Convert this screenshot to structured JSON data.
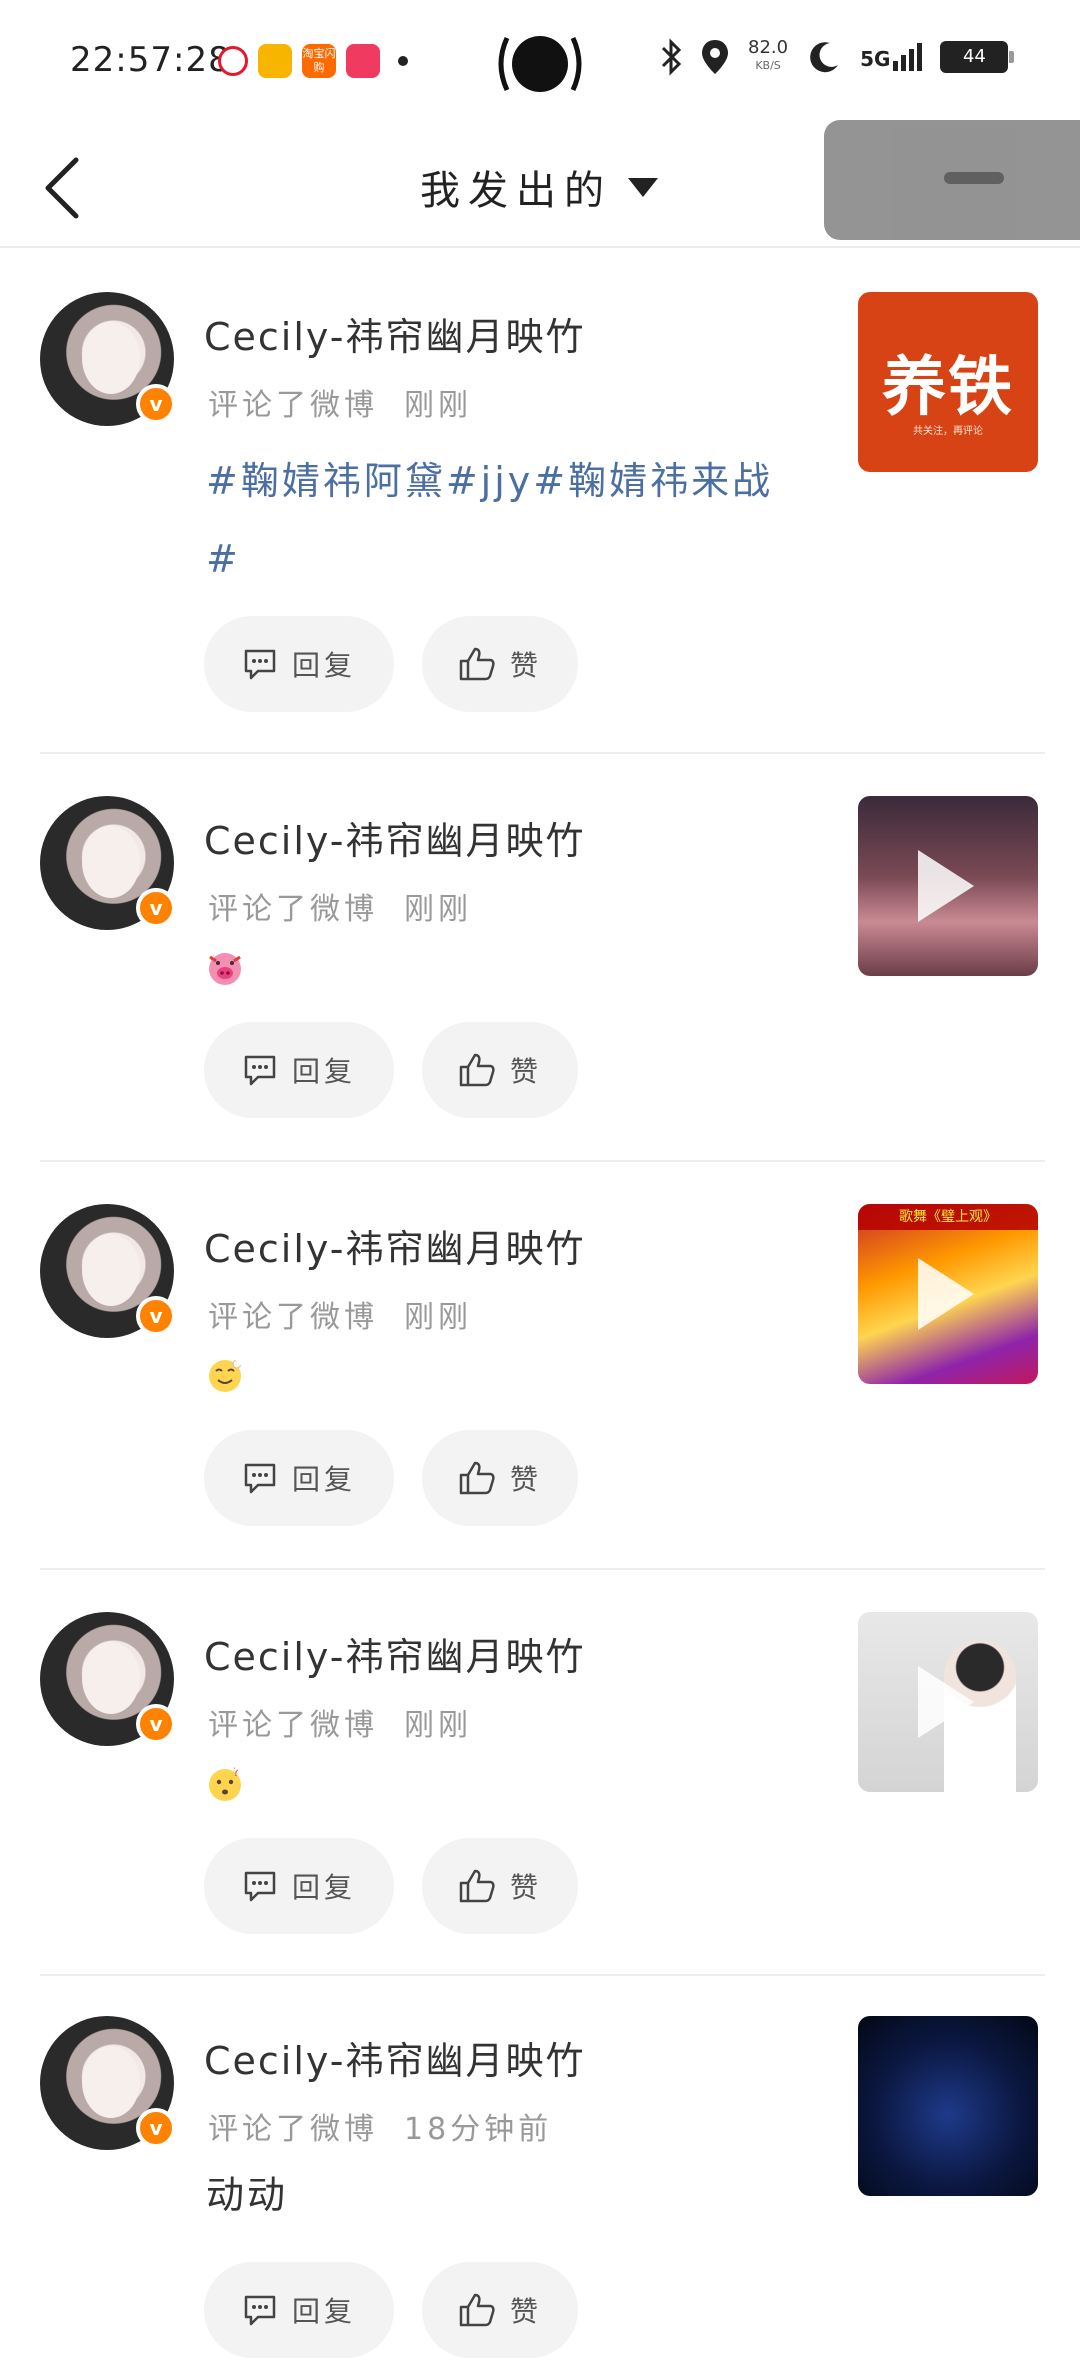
{
  "status_bar": {
    "time": "22:57:28",
    "taobao_label": "淘宝闪购",
    "net_speed": "82.0",
    "net_speed_unit": "KB/S",
    "signal": "5G",
    "battery": "44"
  },
  "nav": {
    "title": "我发出的"
  },
  "colors": {
    "hashtag": "#4b6fa3",
    "verified_badge": "#ff8200",
    "button_bg": "#f3f3f3"
  },
  "items": [
    {
      "username": "Cecily-祎帘幽月映竹",
      "action": "评论了微博",
      "time": "刚刚",
      "content": "#鞠婧祎阿黛#jjy#鞠婧祎来战#",
      "reply_label": "回复",
      "like_label": "赞",
      "thumb_title": "养铁",
      "thumb_caption": "共关注，再评论"
    },
    {
      "username": "Cecily-祎帘幽月映竹",
      "action": "评论了微博",
      "time": "刚刚",
      "emoji": "pig-face-emoji",
      "reply_label": "回复",
      "like_label": "赞"
    },
    {
      "username": "Cecily-祎帘幽月映竹",
      "action": "评论了微博",
      "time": "刚刚",
      "emoji": "smile-emoji",
      "reply_label": "回复",
      "like_label": "赞",
      "thumb_title": "歌舞《璧上观》"
    },
    {
      "username": "Cecily-祎帘幽月映竹",
      "action": "评论了微博",
      "time": "刚刚",
      "emoji": "thinking-emoji",
      "reply_label": "回复",
      "like_label": "赞"
    },
    {
      "username": "Cecily-祎帘幽月映竹",
      "action": "评论了微博",
      "time": "18分钟前",
      "content": "动动",
      "reply_label": "回复",
      "like_label": "赞"
    }
  ]
}
